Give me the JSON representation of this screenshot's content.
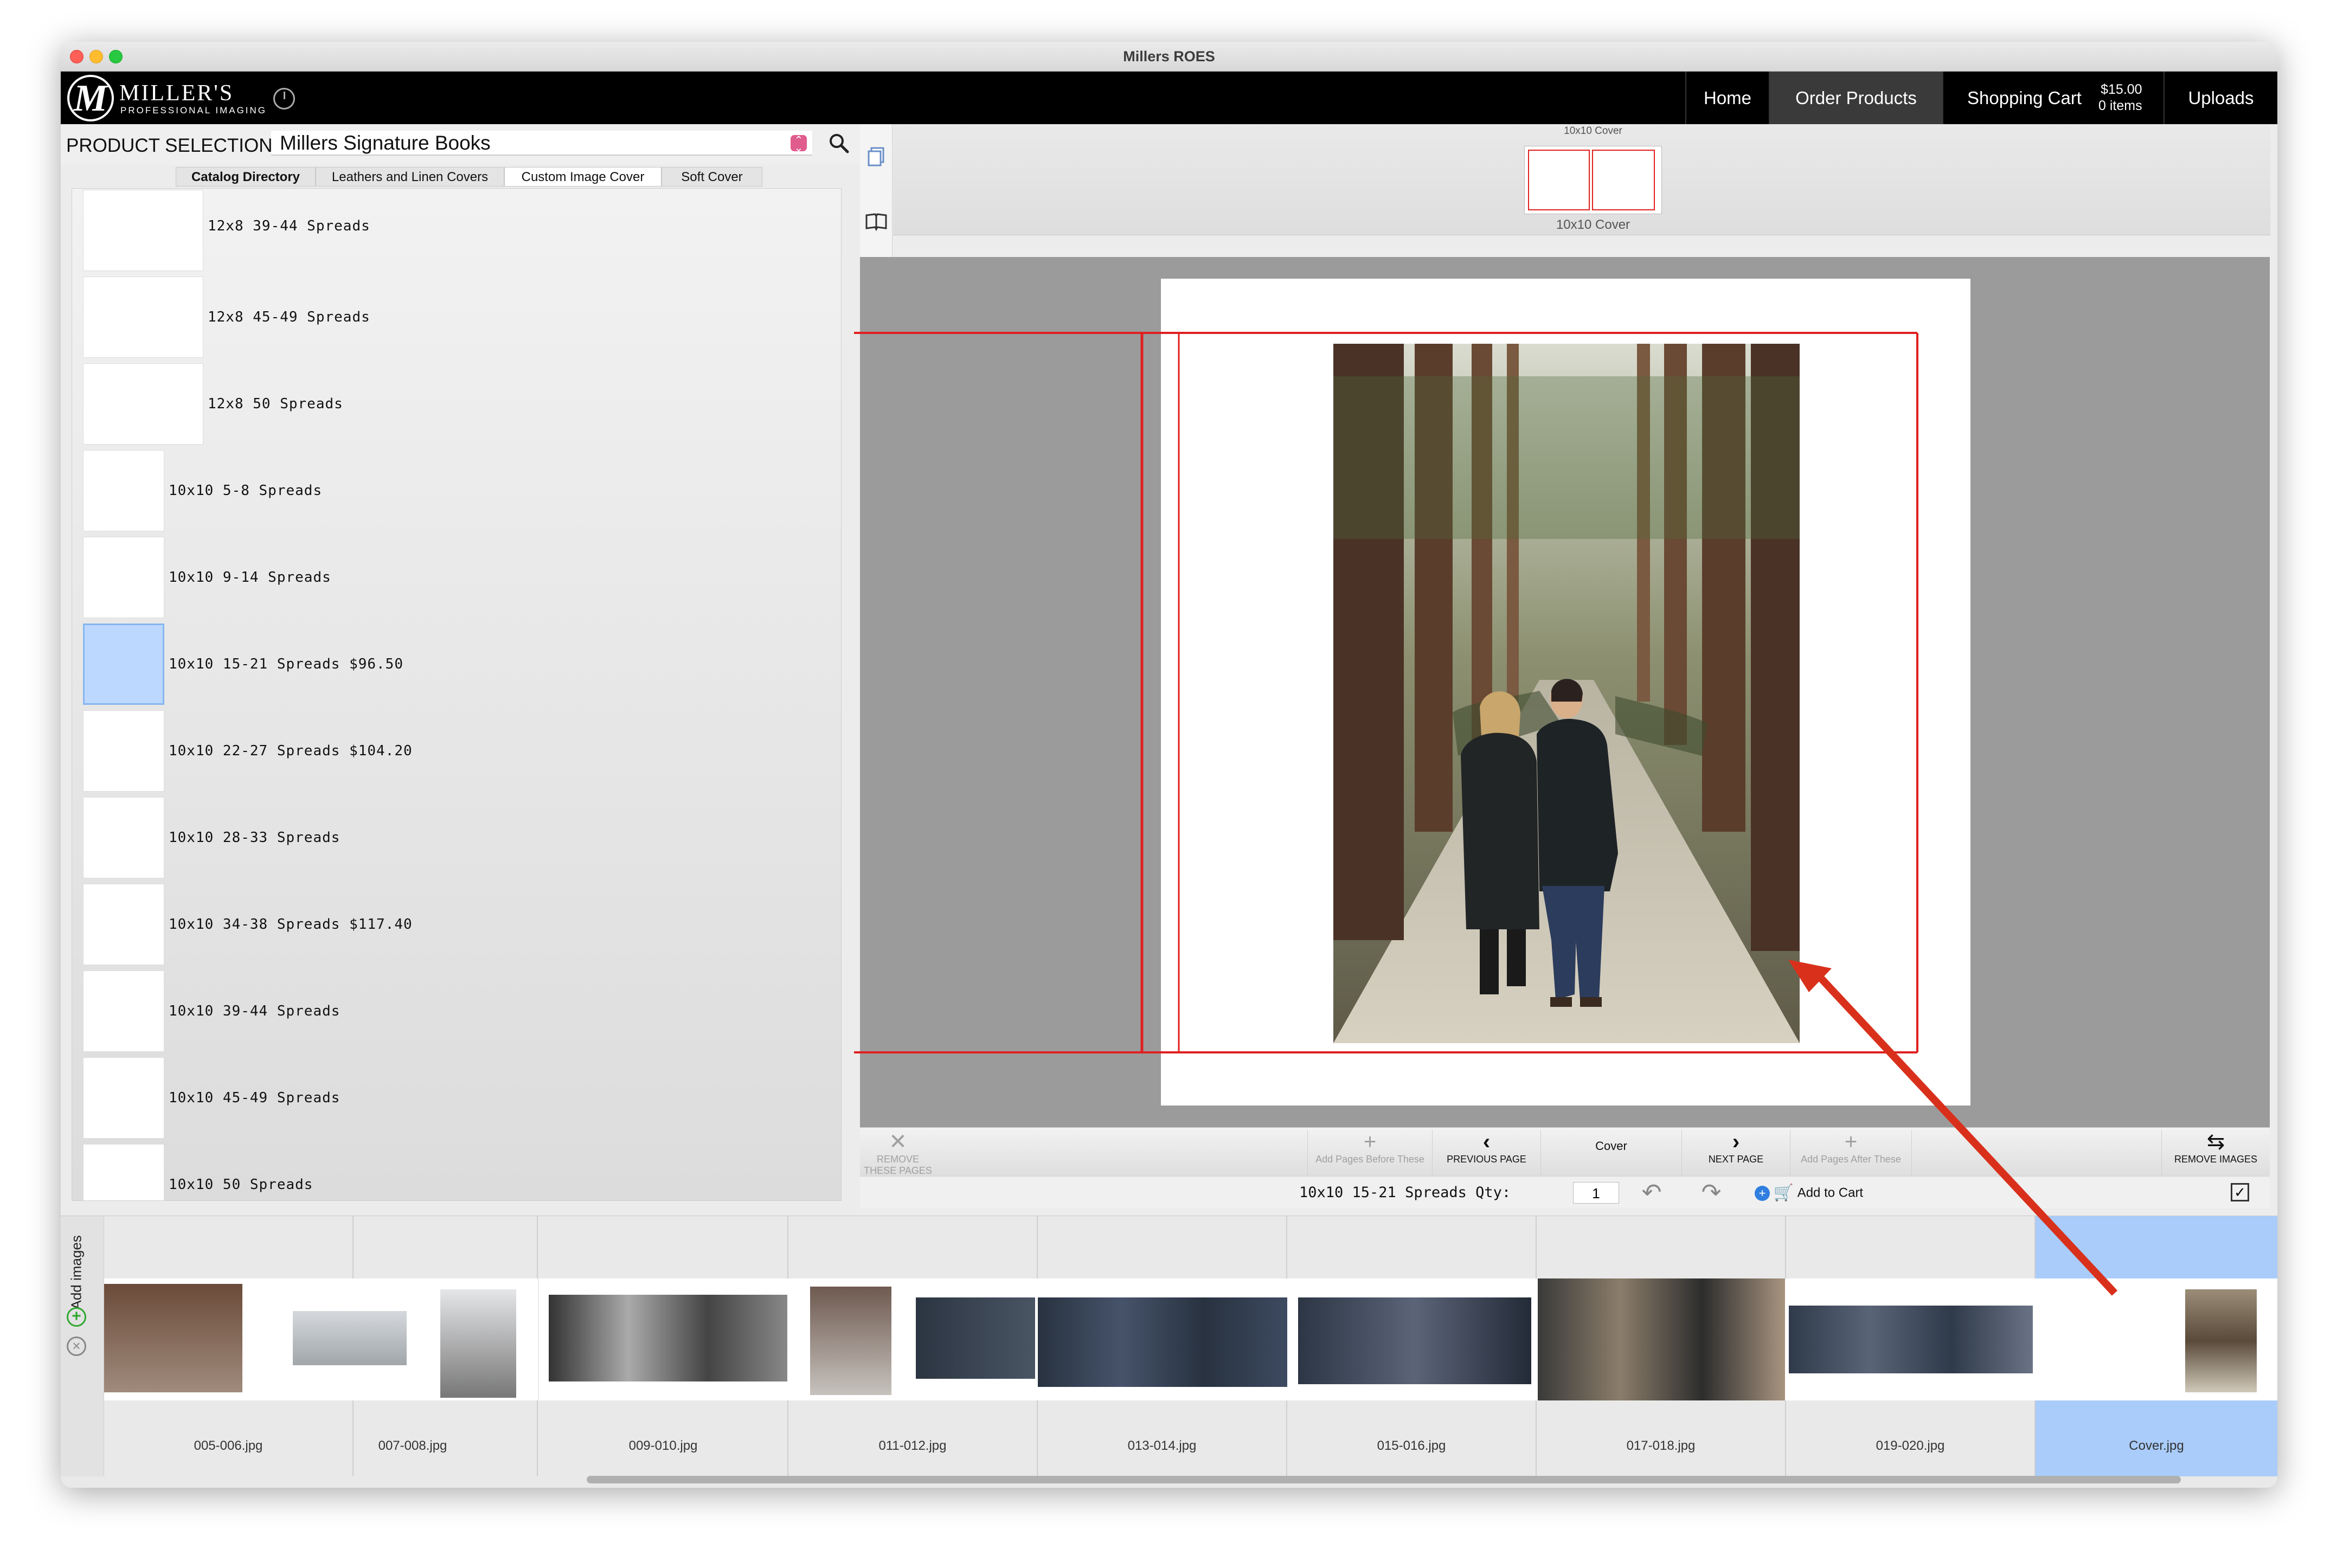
{
  "window": {
    "title": "Millers ROES"
  },
  "brand": {
    "name": "MILLER'S",
    "sub": "PROFESSIONAL IMAGING",
    "monogram": "M"
  },
  "nav": {
    "home": "Home",
    "order_products": "Order Products",
    "shopping_cart": "Shopping Cart",
    "cart_price": "$15.00",
    "cart_items": "0 items",
    "uploads": "Uploads"
  },
  "product_selection": {
    "label": "PRODUCT SELECTION",
    "selected": "Millers Signature Books"
  },
  "tabs": [
    "Catalog Directory",
    "Leathers and Linen Covers",
    "Custom Image Cover",
    "Soft Cover"
  ],
  "catalog_items": [
    {
      "label": "12x8 39-44 Spreads"
    },
    {
      "label": "12x8 45-49 Spreads"
    },
    {
      "label": "12x8 50 Spreads"
    },
    {
      "label": "10x10 5-8 Spreads"
    },
    {
      "label": "10x10 9-14 Spreads"
    },
    {
      "label": "10x10 15-21 Spreads $96.50"
    },
    {
      "label": "10x10 22-27 Spreads $104.20"
    },
    {
      "label": "10x10 28-33 Spreads"
    },
    {
      "label": "10x10 34-38 Spreads $117.40"
    },
    {
      "label": "10x10 39-44 Spreads"
    },
    {
      "label": "10x10 45-49 Spreads"
    },
    {
      "label": "10x10 50 Spreads"
    }
  ],
  "cover_nav": {
    "top_label": "10x10 Cover",
    "bottom_label": "10x10 Cover"
  },
  "toolbar": {
    "remove_pages": "REMOVE THESE PAGES",
    "add_before": "Add Pages Before These",
    "previous": "PREVIOUS PAGE",
    "current": "Cover",
    "next": "NEXT PAGE",
    "add_after": "Add Pages After These",
    "remove_images": "REMOVE IMAGES"
  },
  "qty": {
    "label": "10x10 15-21 Spreads Qty:",
    "value": "1",
    "add_to_cart": "Add to Cart"
  },
  "strip": {
    "add_images": "Add images",
    "files": [
      "005-006.jpg",
      "007-008.jpg",
      "009-010.jpg",
      "011-012.jpg",
      "013-014.jpg",
      "015-016.jpg",
      "017-018.jpg",
      "019-020.jpg",
      "Cover.jpg"
    ]
  },
  "colors": {
    "accent": "#e02020",
    "selection": "#a9ccfa",
    "plus": "#31a832"
  }
}
